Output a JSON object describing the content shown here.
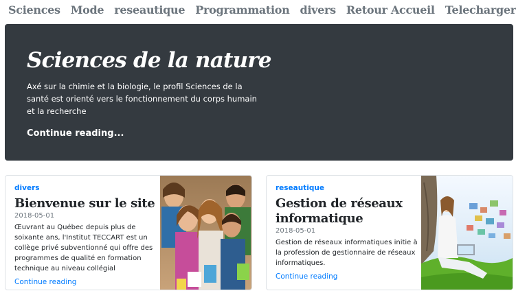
{
  "nav": {
    "items": [
      "Sciences",
      "Mode",
      "reseautique",
      "Programmation",
      "divers",
      "Retour Accueil",
      "Telecharger ce template"
    ]
  },
  "hero": {
    "title": "Sciences de la nature",
    "lead": "Axé sur la chimie et la biologie, le profil Sciences de la santé est orienté vers le fonctionnement du corps humain et la recherche",
    "link": "Continue reading..."
  },
  "posts": [
    {
      "category": "divers",
      "title": "Bienvenue sur le site",
      "date": "2018-05-01",
      "excerpt": "Œuvrant au Québec depuis plus de soixante ans, l'Institut TECCART est un collège privé subventionné qui offre des programmes de qualité en formation technique au niveau collégial",
      "link": "Continue reading"
    },
    {
      "category": "reseautique",
      "title": "Gestion de réseaux informatique",
      "date": "2018-05-01",
      "excerpt": "Gestion de réseaux informatiques initie à la profession de gestionnaire de réseaux informatiques.",
      "link": "Continue reading"
    }
  ],
  "colors": {
    "hero_bg": "#343a40",
    "link": "#007bff",
    "nav_text": "#6c757d"
  }
}
